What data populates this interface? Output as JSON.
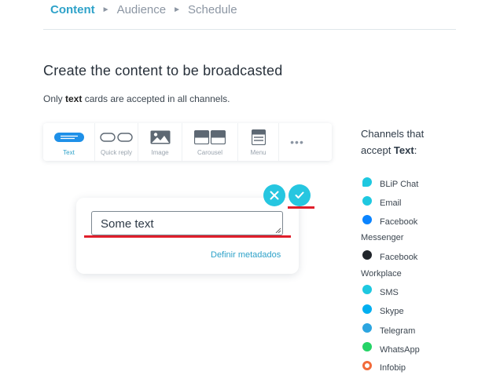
{
  "breadcrumb": {
    "steps": [
      "Content",
      "Audience",
      "Schedule"
    ],
    "separator": "►",
    "active_index": 0
  },
  "heading": "Create the content to be broadcasted",
  "subtext": {
    "prefix": "Only ",
    "bold": "text",
    "suffix": " cards are accepted in all channels."
  },
  "toolbar": {
    "items": [
      {
        "label": "Text",
        "icon": "text-card-icon",
        "active": true
      },
      {
        "label": "Quick reply",
        "icon": "quick-reply-icon",
        "active": false
      },
      {
        "label": "Image",
        "icon": "image-icon",
        "active": false
      },
      {
        "label": "Carousel",
        "icon": "carousel-icon",
        "active": false
      },
      {
        "label": "Menu",
        "icon": "menu-icon",
        "active": false
      },
      {
        "label": "",
        "icon": "more-options-icon",
        "glyph": "•••",
        "active": false
      }
    ]
  },
  "editor": {
    "text_value": "Some text",
    "metadata_link": "Definir metadados",
    "cancel_icon": "close-icon",
    "confirm_icon": "check-icon"
  },
  "channels": {
    "title_prefix": "Channels that accept ",
    "title_bold": "Text",
    "title_suffix": ":",
    "items": [
      {
        "name": "BLiP Chat",
        "icon": "blip-chat-icon",
        "color": "#1ec8e0"
      },
      {
        "name": "Email",
        "icon": "email-icon",
        "color": "#1ec8e0"
      },
      {
        "name": "Facebook",
        "name_line2": "Messenger",
        "icon": "messenger-icon",
        "color": "#0a84ff"
      },
      {
        "name": "Facebook",
        "name_line2": "Workplace",
        "icon": "workplace-icon",
        "color": "#20252b"
      },
      {
        "name": "SMS",
        "icon": "sms-icon",
        "color": "#1ec8e0"
      },
      {
        "name": "Skype",
        "icon": "skype-icon",
        "color": "#00aff0"
      },
      {
        "name": "Telegram",
        "icon": "telegram-icon",
        "color": "#2ca5e0"
      },
      {
        "name": "WhatsApp",
        "icon": "whatsapp-icon",
        "color": "#25d366"
      },
      {
        "name": "Infobip",
        "icon": "infobip-icon",
        "color": "#f26b3a"
      }
    ]
  },
  "colors": {
    "accent": "#2ea2c9",
    "button": "#26c6e0",
    "annotation_red": "#e01e2b"
  }
}
